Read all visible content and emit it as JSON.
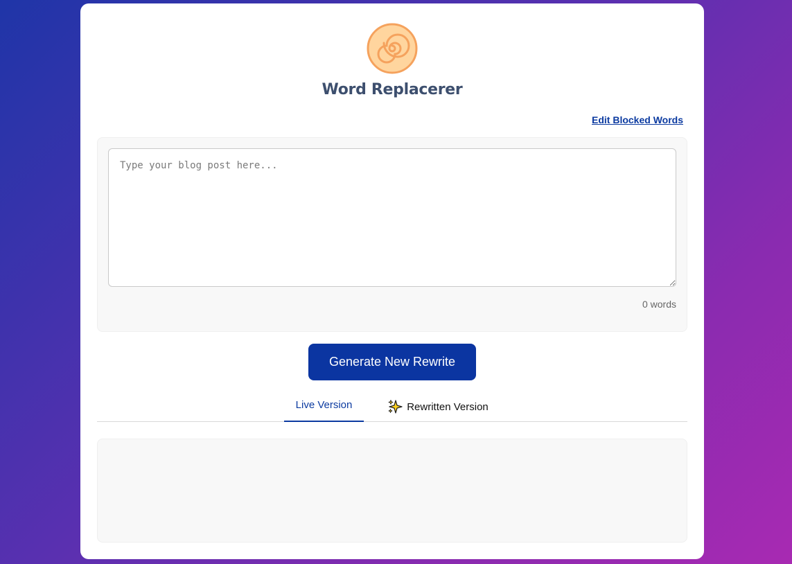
{
  "app": {
    "title": "Word Replacerer",
    "logo_icon": "swirl-icon"
  },
  "header": {
    "edit_link_label": "Edit Blocked Words"
  },
  "editor": {
    "value": "",
    "placeholder": "Type your blog post here...",
    "word_count": "0 words"
  },
  "actions": {
    "generate_label": "Generate New Rewrite"
  },
  "tabs": [
    {
      "label": "Live Version",
      "active": true
    },
    {
      "label": "Rewritten Version",
      "icon": "sparkles-icon",
      "active": false
    }
  ],
  "output": {
    "content": ""
  },
  "colors": {
    "accent": "#0b35a1",
    "logo_fill": "#ffd59e",
    "logo_stroke": "#f5a25d",
    "title": "#3d4f6e"
  }
}
